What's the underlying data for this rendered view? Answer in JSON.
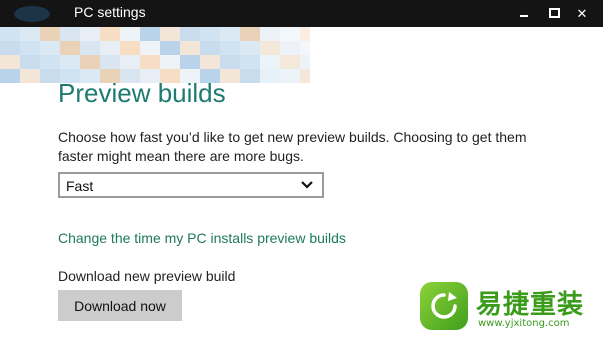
{
  "window": {
    "title": "PC settings",
    "controls": {
      "minimize_icon": "minimize-icon",
      "maximize_icon": "maximize-icon",
      "close_icon": "close-icon",
      "close_glyph": "✕"
    }
  },
  "main": {
    "heading": "Preview builds",
    "description": "Choose how fast you’d like to get new preview builds. Choosing to get them faster might mean there are more bugs.",
    "speed_select": {
      "selected": "Fast"
    },
    "change_time_link": "Change the time my PC installs preview builds",
    "download_label": "Download new preview build",
    "download_button": "Download now"
  },
  "watermark": {
    "name": "易捷重装",
    "url": "www.yjxitong.com"
  },
  "colors": {
    "titlebar": "#141414",
    "heading": "#1f7a6f",
    "link": "#1f7a5a",
    "button": "#cccccc",
    "watermark": "#3b9b1b"
  }
}
